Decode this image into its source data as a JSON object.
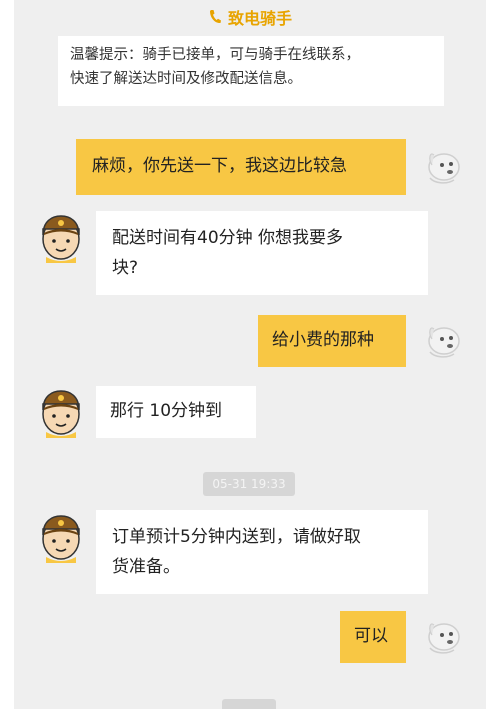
{
  "header": {
    "call_label": "致电骑手",
    "accent_color": "#e8a400"
  },
  "notice": {
    "line1": "温馨提示：骑手已接单，可与骑手在线联系，",
    "line2": "快速了解送达时间及修改配送信息。"
  },
  "messages": [
    {
      "sender": "self",
      "line1": "麻烦，你先送一下，我这边比较急"
    },
    {
      "sender": "rider",
      "line1": "配送时间有40分钟  你想我要多",
      "line2": "块?"
    },
    {
      "sender": "self",
      "line1": "给小费的那种"
    },
    {
      "sender": "rider",
      "line1": "那行  10分钟到"
    },
    {
      "sender": "rider",
      "line1": "订单预计5分钟内送到，请做好取",
      "line2": "货准备。"
    },
    {
      "sender": "self",
      "line1": "可以"
    }
  ],
  "timestamp": "05-31 19:33",
  "icons": {
    "phone": "phone-icon",
    "self_avatar": "dog-avatar-icon",
    "rider_avatar": "rider-avatar-icon"
  },
  "colors": {
    "outgoing_bubble": "#f8c744",
    "incoming_bubble": "#ffffff",
    "chat_background": "#efefef"
  }
}
